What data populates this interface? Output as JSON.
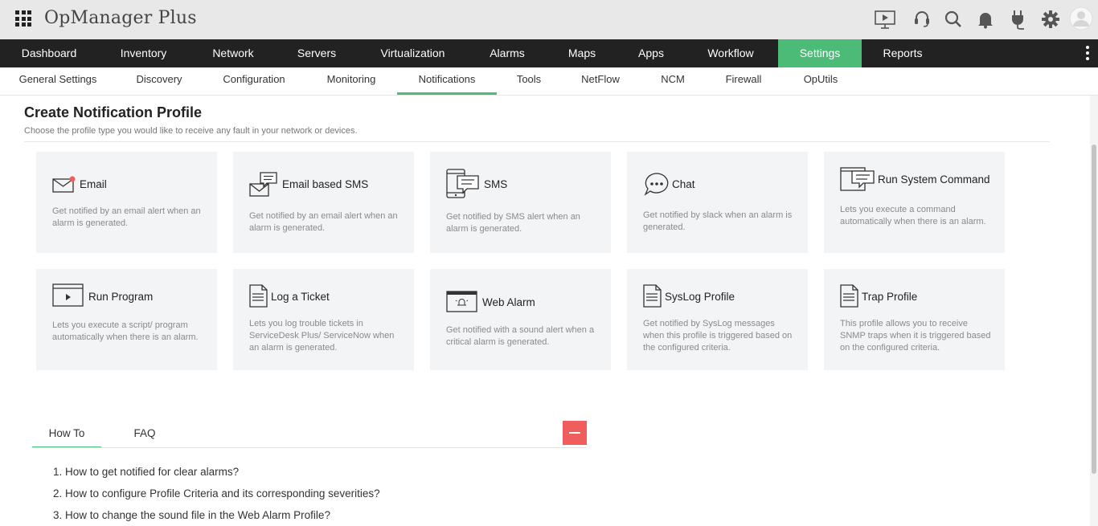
{
  "header": {
    "app_title": "OpManager Plus",
    "icons": [
      "presentation-icon",
      "headset-icon",
      "search-icon",
      "bell-icon",
      "plug-icon",
      "gear-icon",
      "user-avatar-icon"
    ]
  },
  "main_nav": {
    "tabs": [
      {
        "label": "Dashboard"
      },
      {
        "label": "Inventory"
      },
      {
        "label": "Network"
      },
      {
        "label": "Servers"
      },
      {
        "label": "Virtualization"
      },
      {
        "label": "Alarms"
      },
      {
        "label": "Maps"
      },
      {
        "label": "Apps"
      },
      {
        "label": "Workflow"
      },
      {
        "label": "Settings"
      },
      {
        "label": "Reports"
      }
    ],
    "active": "Settings",
    "accent_color": "#4cbb78"
  },
  "sub_nav": {
    "tabs": [
      {
        "label": "General Settings"
      },
      {
        "label": "Discovery"
      },
      {
        "label": "Configuration"
      },
      {
        "label": "Monitoring"
      },
      {
        "label": "Notifications"
      },
      {
        "label": "Tools"
      },
      {
        "label": "NetFlow"
      },
      {
        "label": "NCM"
      },
      {
        "label": "Firewall"
      },
      {
        "label": "OpUtils"
      }
    ],
    "active": "Notifications"
  },
  "page": {
    "title": "Create Notification Profile",
    "subtitle": "Choose the profile type you would like to receive any fault in your network or devices."
  },
  "profiles": [
    {
      "title": "Email",
      "desc": "Get notified by an email alert when an alarm is generated.",
      "icon": "envelope-icon"
    },
    {
      "title": "Email based SMS",
      "desc": "Get notified by an email alert when an alarm is generated.",
      "icon": "email-sms-icon"
    },
    {
      "title": "SMS",
      "desc": "Get notified by SMS alert when an alarm is generated.",
      "icon": "mobile-sms-icon"
    },
    {
      "title": "Chat",
      "desc": "Get notified by slack when an alarm is generated.",
      "icon": "chat-bubble-icon"
    },
    {
      "title": "Run System Command",
      "desc": "Lets you execute a command automatically when there is an alarm.",
      "icon": "system-command-icon"
    },
    {
      "title": "Run Program",
      "desc": "Lets you execute a script/ program automatically when there is an alarm.",
      "icon": "run-program-icon"
    },
    {
      "title": "Log a Ticket",
      "desc": "Lets you log trouble tickets in ServiceDesk Plus/ ServiceNow when an alarm is generated.",
      "icon": "ticket-document-icon"
    },
    {
      "title": "Web Alarm",
      "desc": "Get notified with a sound alert when a critical alarm is generated.",
      "icon": "web-alarm-icon"
    },
    {
      "title": "SysLog Profile",
      "desc": "Get notified by SysLog messages when this profile is triggered based on the configured criteria.",
      "icon": "syslog-document-icon"
    },
    {
      "title": "Trap Profile",
      "desc": "This profile allows you to receive SNMP traps when it is triggered based on the configured criteria.",
      "icon": "trap-document-icon"
    }
  ],
  "help": {
    "tabs": [
      {
        "label": "How To"
      },
      {
        "label": "FAQ"
      }
    ],
    "active": "How To",
    "collapse_color": "#f05d5d",
    "questions": [
      "1. How to get notified for clear alarms?",
      "2. How to configure Profile Criteria and its corresponding severities?",
      "3. How to change the sound file in the Web Alarm Profile?"
    ]
  }
}
